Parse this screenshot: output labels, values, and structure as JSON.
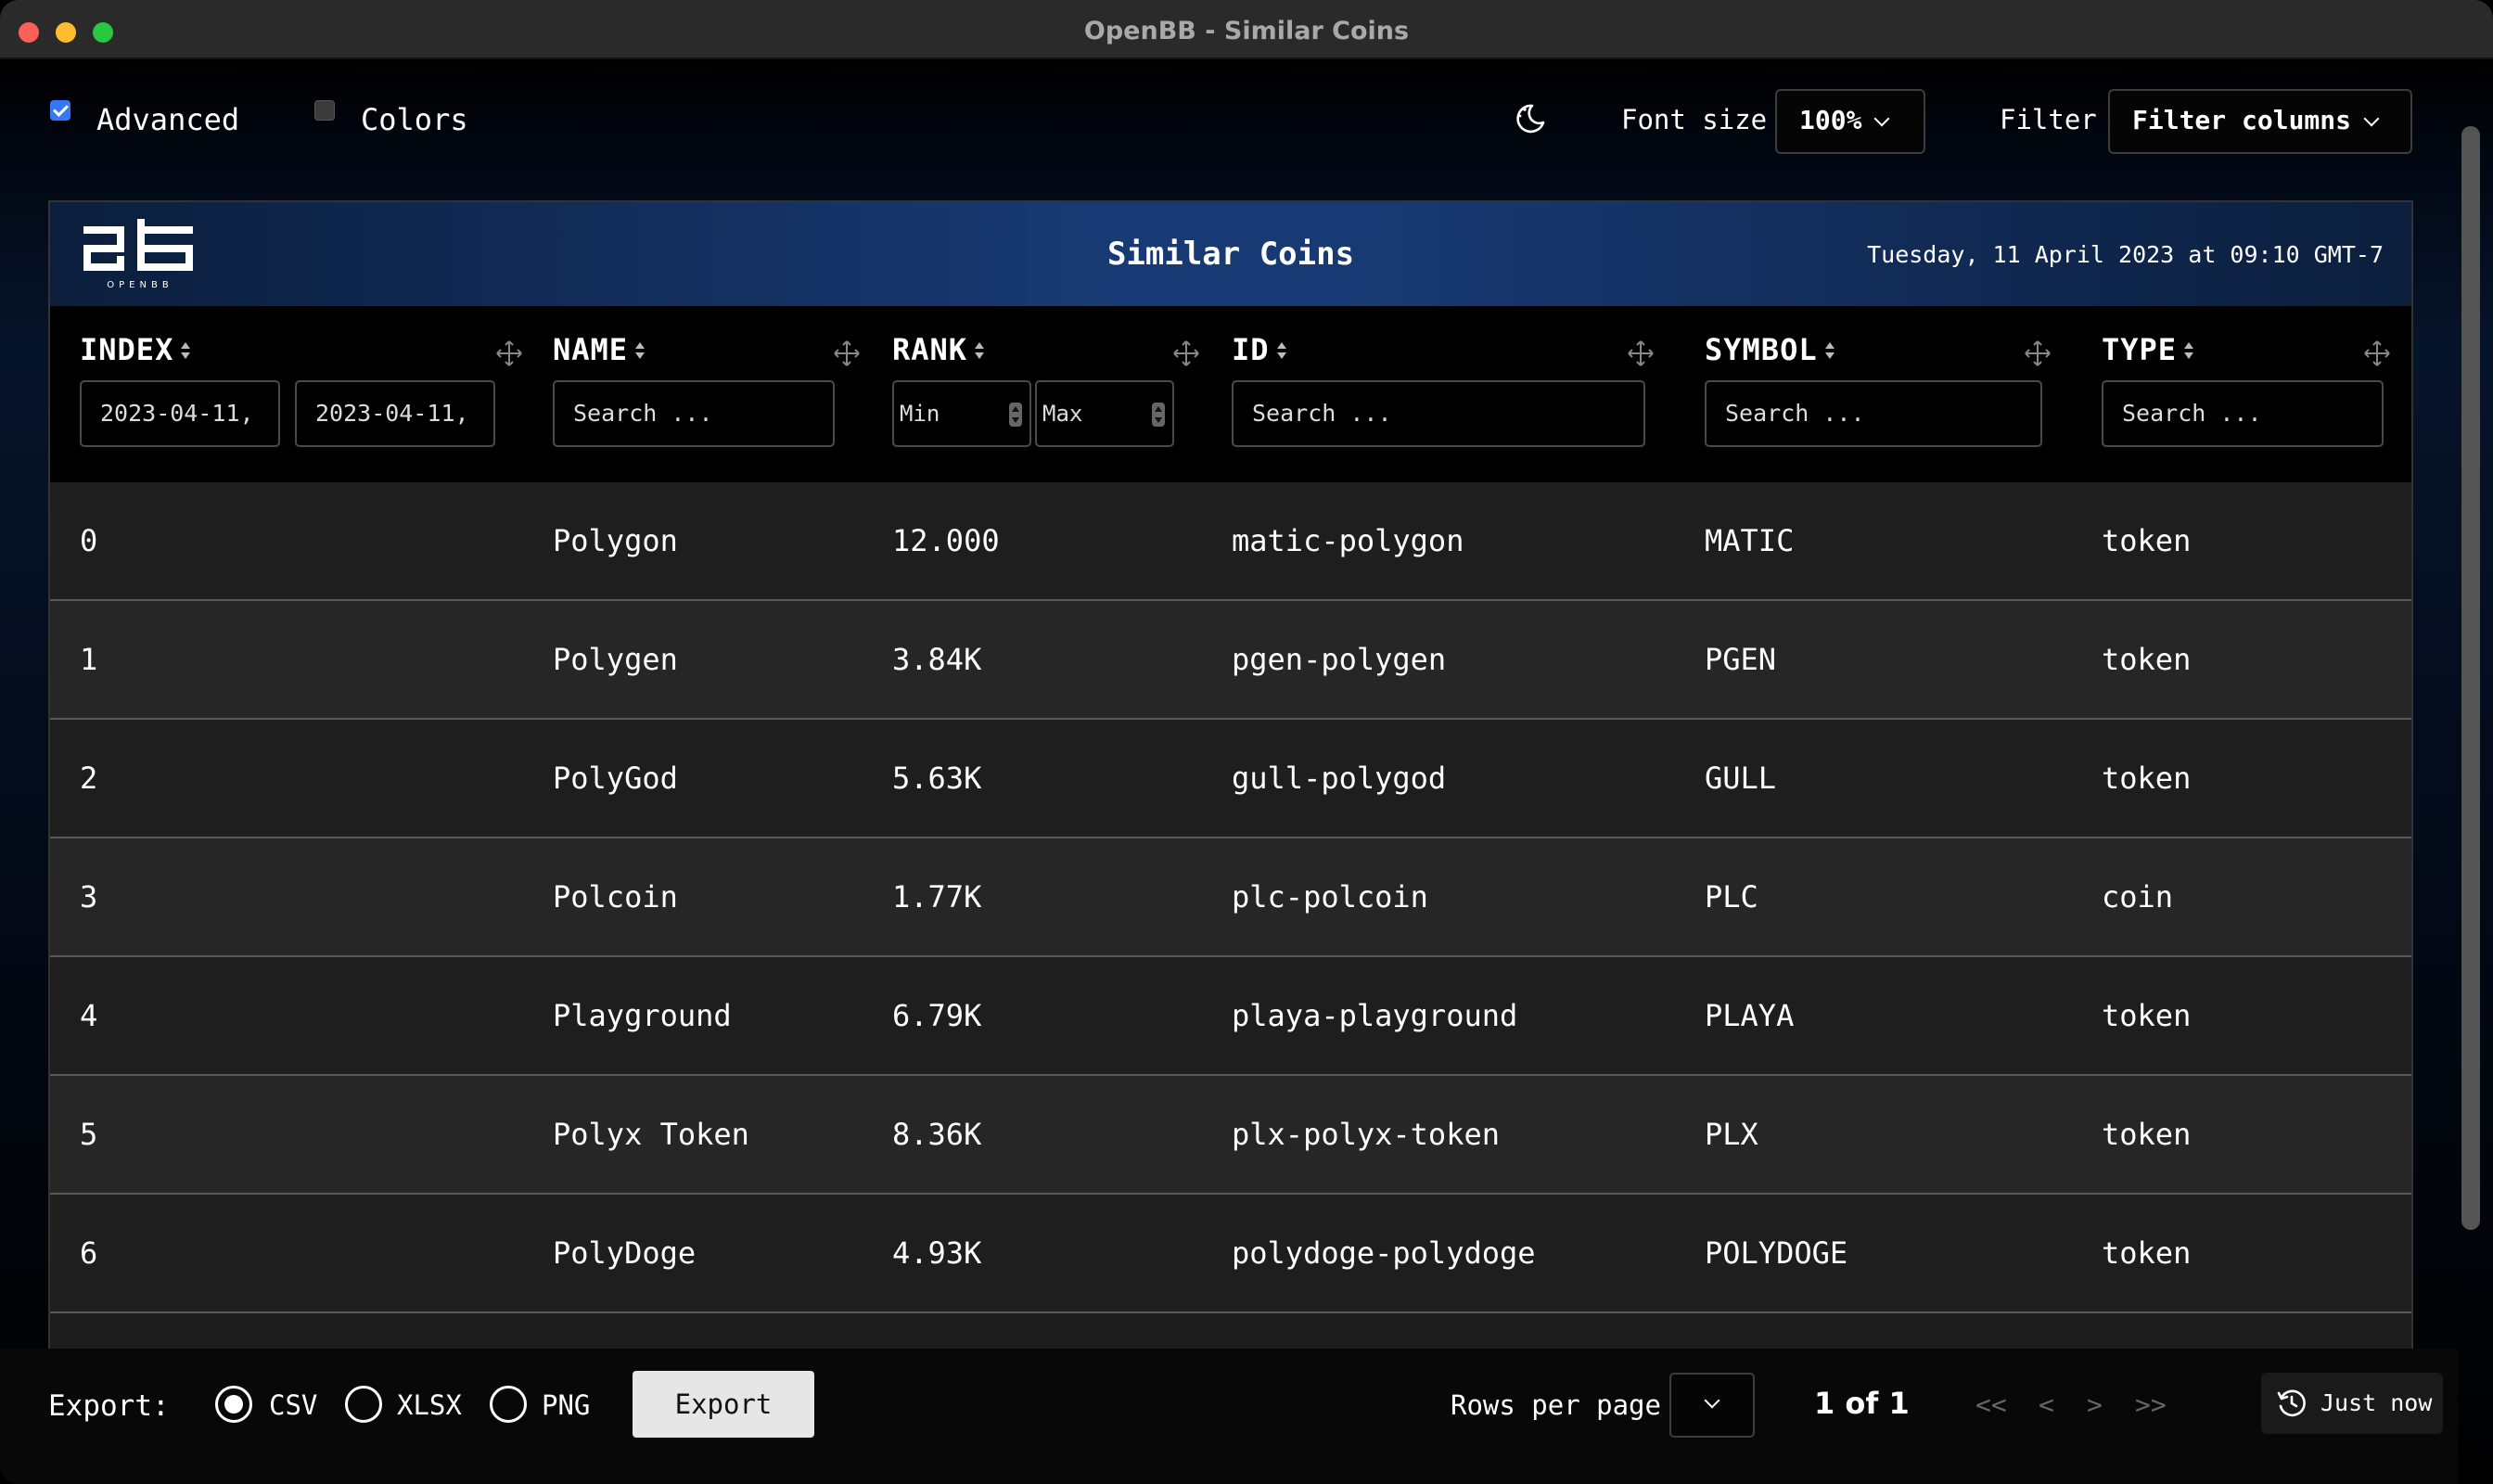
{
  "window": {
    "title": "OpenBB - Similar Coins"
  },
  "toolbar": {
    "advanced_label": "Advanced",
    "advanced_checked": true,
    "colors_label": "Colors",
    "colors_checked": false,
    "theme_icon": "moon-stars-icon",
    "font_size_label": "Font size",
    "font_size_value": "100%",
    "filter_label": "Filter",
    "filter_value": "Filter columns"
  },
  "banner": {
    "logo_text": "OPENBB",
    "title": "Similar Coins",
    "date": "Tuesday, 11 April 2023 at 09:10 GMT-7"
  },
  "columns": [
    {
      "key": "index",
      "label": "INDEX"
    },
    {
      "key": "name",
      "label": "NAME"
    },
    {
      "key": "rank",
      "label": "RANK"
    },
    {
      "key": "id",
      "label": "ID"
    },
    {
      "key": "symbol",
      "label": "SYMBOL"
    },
    {
      "key": "type",
      "label": "TYPE"
    }
  ],
  "filters": {
    "index_from": "2023-04-11,",
    "index_to": "2023-04-11,",
    "name_placeholder": "Search ...",
    "rank_min_placeholder": "Min",
    "rank_max_placeholder": "Max",
    "id_placeholder": "Search ...",
    "symbol_placeholder": "Search ...",
    "type_placeholder": "Search ..."
  },
  "rows": [
    {
      "index": "0",
      "name": "Polygon",
      "rank": "12.000",
      "id": "matic-polygon",
      "symbol": "MATIC",
      "type": "token"
    },
    {
      "index": "1",
      "name": "Polygen",
      "rank": "3.84K",
      "id": "pgen-polygen",
      "symbol": "PGEN",
      "type": "token"
    },
    {
      "index": "2",
      "name": "PolyGod",
      "rank": "5.63K",
      "id": "gull-polygod",
      "symbol": "GULL",
      "type": "token"
    },
    {
      "index": "3",
      "name": "Polcoin",
      "rank": "1.77K",
      "id": "plc-polcoin",
      "symbol": "PLC",
      "type": "coin"
    },
    {
      "index": "4",
      "name": "Playground",
      "rank": "6.79K",
      "id": "playa-playground",
      "symbol": "PLAYA",
      "type": "token"
    },
    {
      "index": "5",
      "name": "Polyx Token",
      "rank": "8.36K",
      "id": "plx-polyx-token",
      "symbol": "PLX",
      "type": "token"
    },
    {
      "index": "6",
      "name": "PolyDoge",
      "rank": "4.93K",
      "id": "polydoge-polydoge",
      "symbol": "POLYDOGE",
      "type": "token"
    }
  ],
  "footer": {
    "export_label": "Export:",
    "formats": [
      "CSV",
      "XLSX",
      "PNG"
    ],
    "selected_format": "CSV",
    "export_button": "Export",
    "rows_per_page_label": "Rows per page",
    "page_info": "1 of 1",
    "nav_first": "<<",
    "nav_prev": "<",
    "nav_next": ">",
    "nav_last": ">>",
    "refresh_label": "Just now"
  },
  "colors": {
    "accent": "#3478f6",
    "banner": "#183a74",
    "export_button_bg": "#e6e6e6"
  }
}
